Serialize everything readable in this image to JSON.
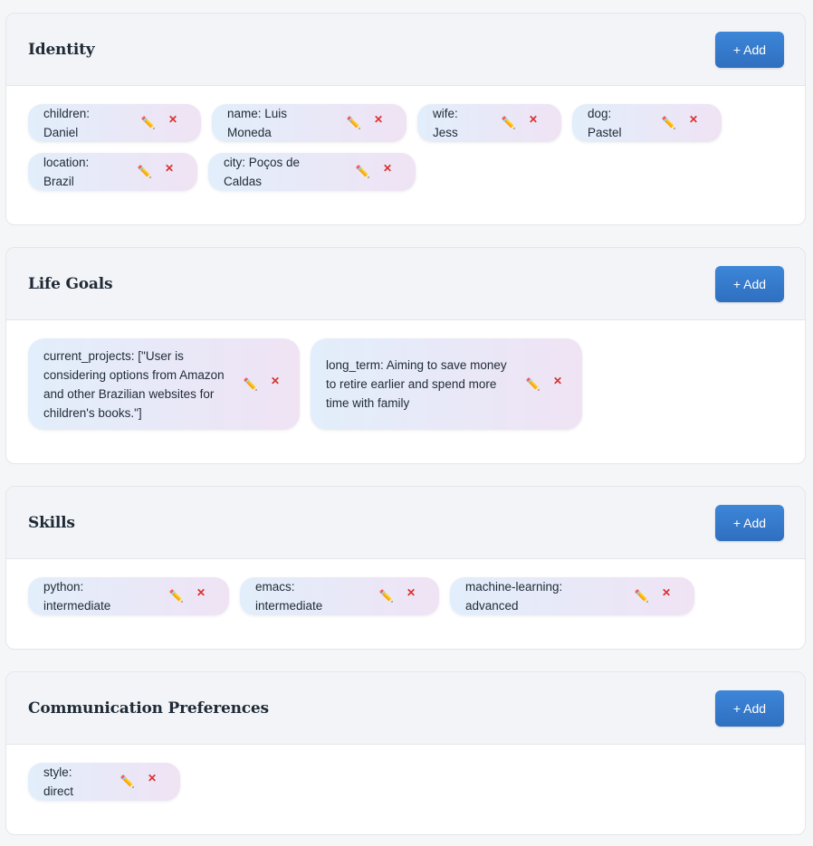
{
  "sections": [
    {
      "title": "Identity",
      "add_label": "+ Add",
      "chips": [
        "children: Daniel",
        "name: Luis Moneda",
        "wife: Jess",
        "dog: Pastel",
        "location: Brazil",
        "city: Poços de Caldas"
      ]
    },
    {
      "title": "Life Goals",
      "add_label": "+ Add",
      "chips": [
        "current_projects: [\"User is considering options from Amazon and other Brazilian websites for children's books.\"]",
        "long_term: Aiming to save money to retire earlier and spend more time with family"
      ]
    },
    {
      "title": "Skills",
      "add_label": "+ Add",
      "chips": [
        "python: intermediate",
        "emacs: intermediate",
        "machine-learning: advanced"
      ]
    },
    {
      "title": "Communication Preferences",
      "add_label": "+ Add",
      "chips": [
        "style: direct"
      ]
    }
  ],
  "icons": {
    "edit": "pencil-icon",
    "delete": "close-icon"
  },
  "colors": {
    "accent": "#2f6fc0",
    "delete": "#d9302c",
    "edit": "#e0a020"
  }
}
